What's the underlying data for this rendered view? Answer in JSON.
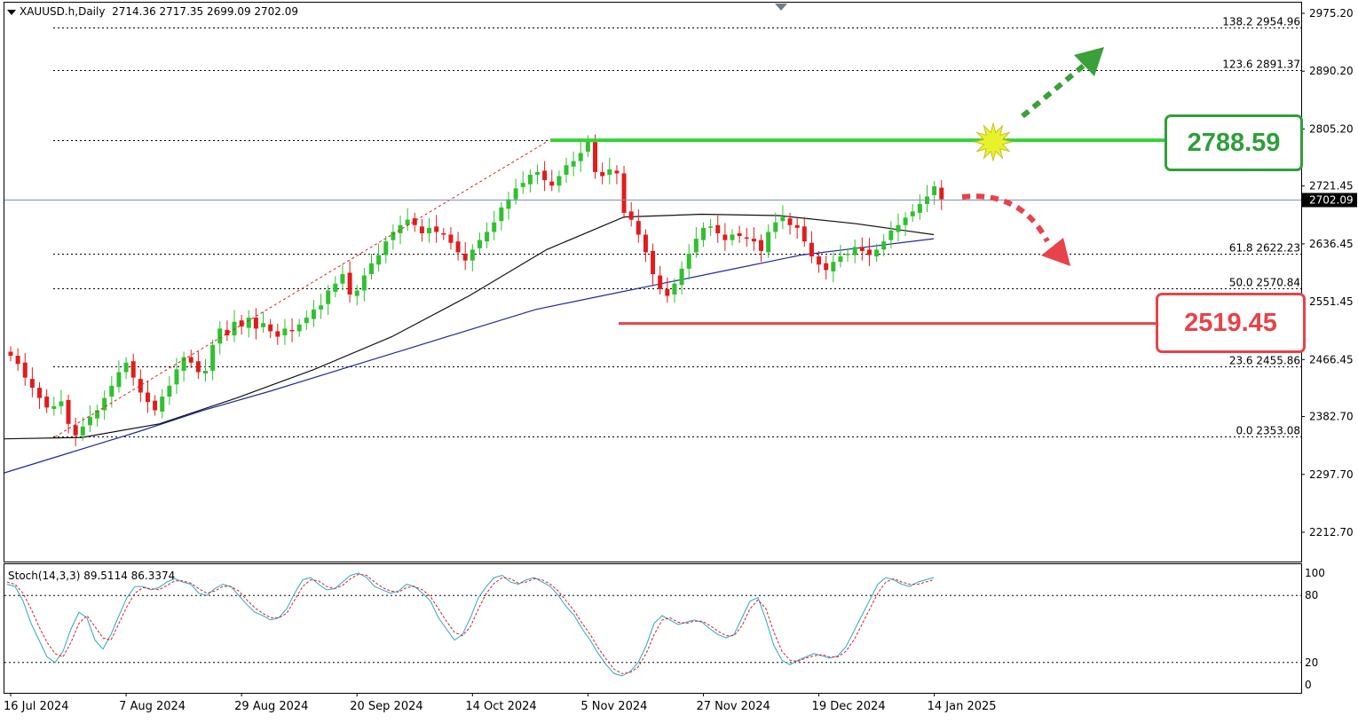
{
  "header": {
    "symbol": "XAUUSD.h,Daily",
    "ohlc": "2714.36 2717.35 2699.09 2702.09"
  },
  "stochastic": {
    "label": "Stoch(14,3,3) 89.5114 86.3374",
    "levels": [
      "100",
      "80",
      "20",
      "0"
    ]
  },
  "key_levels": {
    "resistance_label": "2788.59",
    "support_label": "2519.45",
    "resistance": 2788.59,
    "support": 2519.45,
    "resistance_color": "#2f9e3a",
    "support_color": "#e8424a",
    "bullish_arrow_color": "#3aa03a",
    "bearish_arrow_color": "#e8424a"
  },
  "chart_data": {
    "type": "candlestick",
    "title": "",
    "price_axis": {
      "ticks": [
        "2975.20",
        "2890.20",
        "2805.20",
        "2721.45",
        "2636.45",
        "2551.45",
        "2466.45",
        "2382.70",
        "2297.70",
        "2212.70"
      ],
      "tick_values": [
        2975.2,
        2890.2,
        2805.2,
        2721.45,
        2636.45,
        2551.45,
        2466.45,
        2382.7,
        2297.7,
        2212.7
      ],
      "current_price_label": "2702.09",
      "current_price": 2702.09,
      "ylim": [
        2150,
        2990
      ]
    },
    "time_axis": {
      "labels": [
        "16 Jul 2024",
        "7 Aug 2024",
        "29 Aug 2024",
        "20 Sep 2024",
        "14 Oct 2024",
        "5 Nov 2024",
        "27 Nov 2024",
        "19 Dec 2024",
        "14 Jan 2025"
      ],
      "label_bar_index": [
        0,
        16,
        32,
        48,
        64,
        80,
        96,
        112,
        128
      ]
    },
    "fibonacci": [
      {
        "label": "138.2 2954.96",
        "price": 2954.96
      },
      {
        "label": "123.6 2891.37",
        "price": 2891.37
      },
      {
        "label": "61.8 2622.23",
        "price": 2622.23
      },
      {
        "label": "50.0 2570.84",
        "price": 2570.84
      },
      {
        "label": "23.6 2455.86",
        "price": 2455.86
      },
      {
        "label": "0.0 2353.08",
        "price": 2353.08
      },
      {
        "label": "",
        "price": 2788.59
      }
    ],
    "candles_close": [
      2472,
      2460,
      2440,
      2425,
      2410,
      2396,
      2398,
      2405,
      2372,
      2355,
      2368,
      2382,
      2392,
      2410,
      2428,
      2448,
      2462,
      2440,
      2418,
      2404,
      2392,
      2412,
      2428,
      2452,
      2470,
      2462,
      2448,
      2450,
      2488,
      2512,
      2502,
      2522,
      2515,
      2528,
      2512,
      2520,
      2508,
      2500,
      2512,
      2508,
      2518,
      2528,
      2540,
      2546,
      2568,
      2578,
      2592,
      2562,
      2568,
      2590,
      2608,
      2620,
      2640,
      2654,
      2664,
      2672,
      2664,
      2652,
      2660,
      2654,
      2650,
      2638,
      2624,
      2612,
      2628,
      2642,
      2654,
      2668,
      2690,
      2702,
      2718,
      2726,
      2738,
      2742,
      2730,
      2722,
      2736,
      2752,
      2758,
      2770,
      2788,
      2742,
      2736,
      2746,
      2740,
      2682,
      2672,
      2650,
      2624,
      2592,
      2570,
      2560,
      2578,
      2600,
      2622,
      2644,
      2660,
      2662,
      2652,
      2642,
      2650,
      2648,
      2644,
      2640,
      2626,
      2654,
      2668,
      2676,
      2664,
      2660,
      2640,
      2618,
      2606,
      2598,
      2610,
      2618,
      2622,
      2632,
      2626,
      2620,
      2628,
      2640,
      2656,
      2664,
      2675,
      2684,
      2695,
      2706,
      2721,
      2702
    ],
    "sma_slow_key": [
      2300,
      2330,
      2360,
      2392,
      2420,
      2450,
      2480,
      2510,
      2540,
      2560,
      2580,
      2600,
      2620,
      2632,
      2644
    ],
    "sma_fast_key": [
      2350,
      2352,
      2372,
      2410,
      2452,
      2500,
      2560,
      2628,
      2676,
      2680,
      2678,
      2666,
      2650
    ],
    "stochastic_k": [
      90,
      88,
      75,
      55,
      40,
      25,
      20,
      30,
      50,
      65,
      60,
      40,
      32,
      45,
      62,
      78,
      88,
      88,
      85,
      87,
      92,
      95,
      92,
      90,
      82,
      80,
      86,
      90,
      88,
      80,
      72,
      65,
      62,
      58,
      60,
      68,
      82,
      94,
      96,
      90,
      85,
      86,
      92,
      98,
      100,
      96,
      88,
      85,
      82,
      84,
      90,
      88,
      82,
      75,
      60,
      50,
      40,
      45,
      60,
      78,
      88,
      96,
      98,
      92,
      90,
      94,
      96,
      92,
      88,
      80,
      70,
      62,
      50,
      40,
      28,
      18,
      10,
      8,
      12,
      20,
      35,
      55,
      62,
      58,
      54,
      56,
      58,
      56,
      50,
      45,
      42,
      45,
      60,
      75,
      78,
      58,
      35,
      22,
      18,
      22,
      25,
      28,
      26,
      24,
      26,
      34,
      48,
      62,
      76,
      90,
      96,
      94,
      90,
      88,
      92,
      94,
      96
    ],
    "stochastic_d": [
      92,
      90,
      82,
      68,
      52,
      38,
      28,
      25,
      38,
      55,
      62,
      52,
      42,
      40,
      55,
      70,
      82,
      87,
      86,
      85,
      89,
      93,
      93,
      91,
      86,
      82,
      84,
      88,
      88,
      84,
      76,
      69,
      64,
      60,
      60,
      64,
      76,
      88,
      94,
      93,
      88,
      86,
      89,
      95,
      99,
      98,
      92,
      87,
      84,
      83,
      87,
      88,
      85,
      79,
      68,
      57,
      47,
      44,
      52,
      68,
      82,
      91,
      96,
      95,
      91,
      92,
      95,
      94,
      90,
      84,
      75,
      66,
      55,
      45,
      33,
      23,
      14,
      10,
      11,
      16,
      28,
      45,
      58,
      60,
      56,
      55,
      57,
      57,
      53,
      48,
      44,
      44,
      53,
      68,
      76,
      68,
      47,
      30,
      22,
      21,
      24,
      26,
      27,
      25,
      25,
      30,
      40,
      54,
      68,
      82,
      92,
      95,
      92,
      90,
      90,
      92,
      94
    ]
  }
}
